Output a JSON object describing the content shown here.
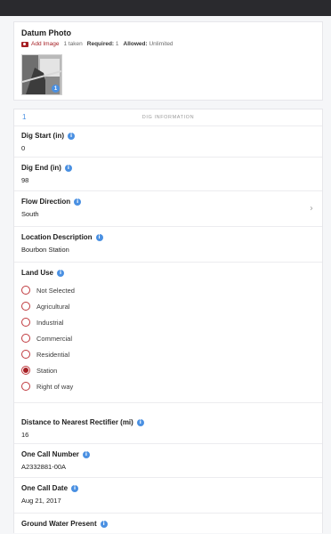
{
  "photo": {
    "title": "Datum Photo",
    "add_image": "Add Image",
    "count_label": "1 taken",
    "required_label": "Required:",
    "required_value": "1",
    "allowed_label": "Allowed:",
    "allowed_value": "Unlimited",
    "badge": "1"
  },
  "section": {
    "back": "1",
    "title": "DIG INFORMATION"
  },
  "fields": {
    "dig_start": {
      "label": "Dig Start (in)",
      "value": "0"
    },
    "dig_end": {
      "label": "Dig End (in)",
      "value": "98"
    },
    "flow_direction": {
      "label": "Flow Direction",
      "value": "South"
    },
    "location_description": {
      "label": "Location Description",
      "value": "Bourbon Station"
    },
    "land_use": {
      "label": "Land Use",
      "options": [
        "Not Selected",
        "Agricultural",
        "Industrial",
        "Commercial",
        "Residential",
        "Station",
        "Right of way"
      ],
      "selected": "Station"
    },
    "distance_rectifier": {
      "label": "Distance to Nearest Rectifier (mi)",
      "value": "16"
    },
    "one_call_number": {
      "label": "One Call Number",
      "value": "A2332881-00A"
    },
    "one_call_date": {
      "label": "One Call Date",
      "value": "Aug 21, 2017"
    },
    "ground_water": {
      "label": "Ground Water Present"
    }
  },
  "colors": {
    "accent_red": "#a51f24",
    "info_blue": "#4a90e2",
    "top_bar": "#2a2a2e"
  },
  "icons": {
    "info": "info-icon",
    "camera": "camera-icon",
    "chevron": "chevron-right-icon"
  }
}
